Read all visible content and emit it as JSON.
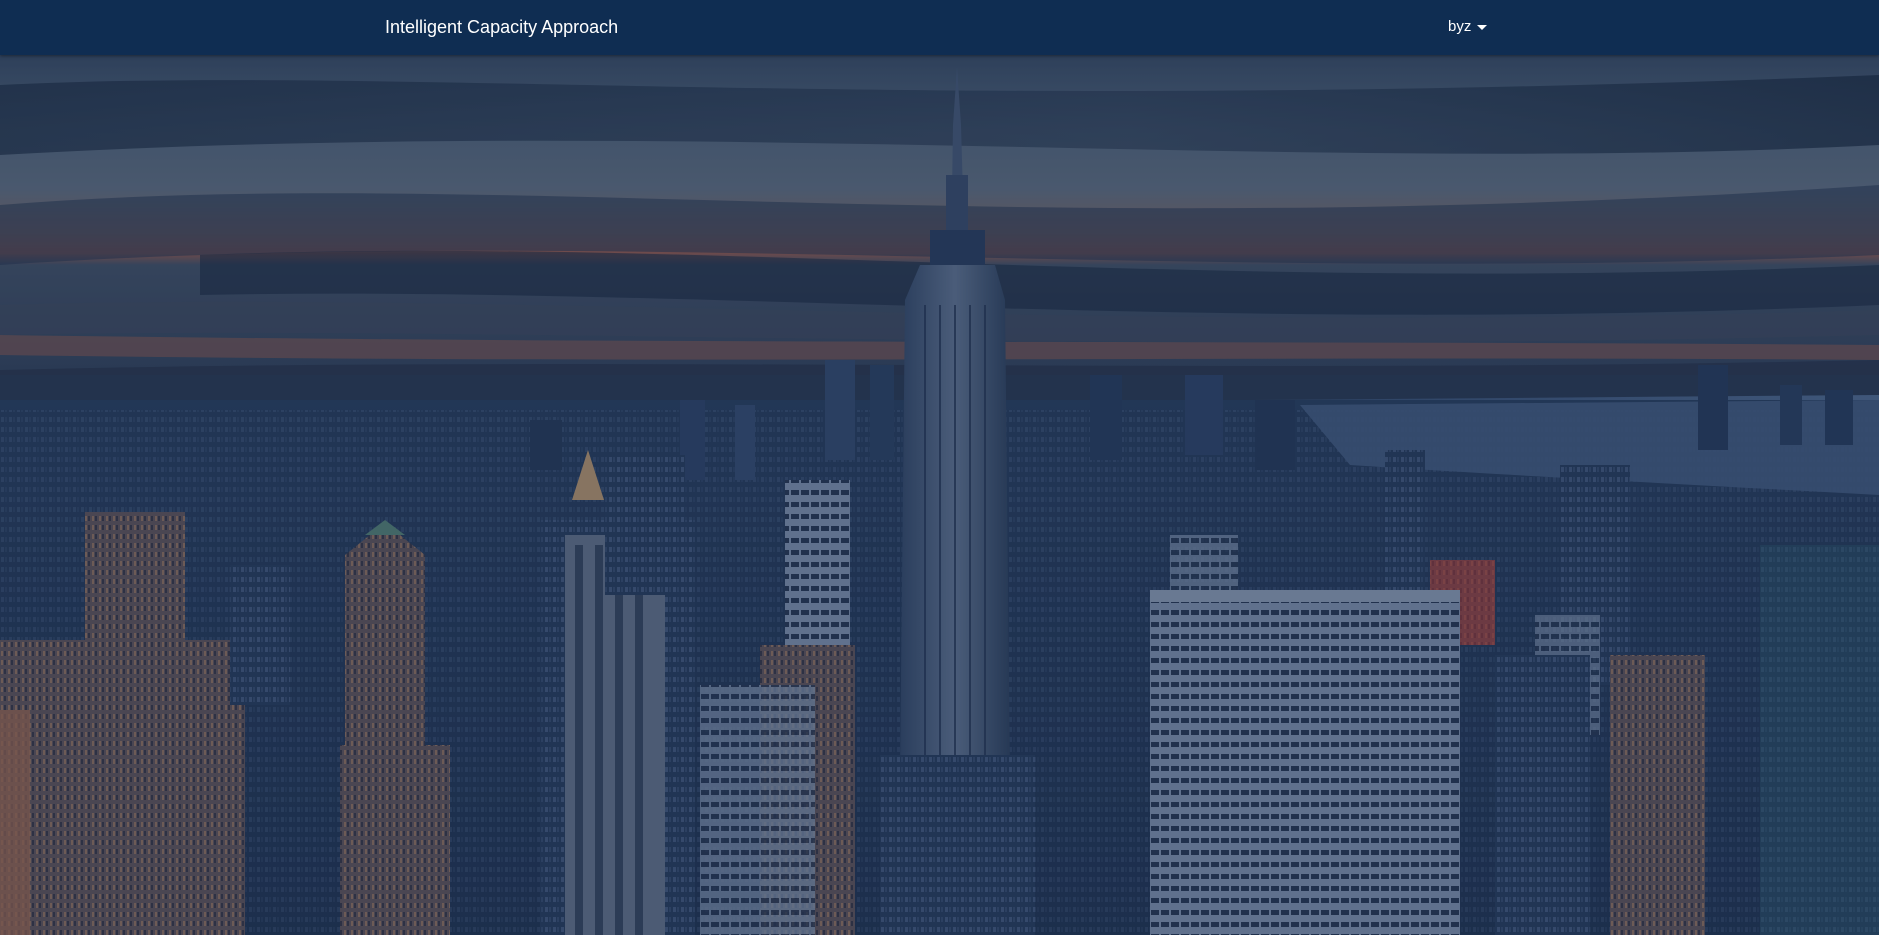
{
  "navbar": {
    "brand": "Intelligent Capacity Approach",
    "user_label": "byz"
  },
  "hero": {
    "image": "city-skyline-dusk-background"
  },
  "colors": {
    "navbar": "#0f2d52",
    "text": "#ffffff"
  }
}
